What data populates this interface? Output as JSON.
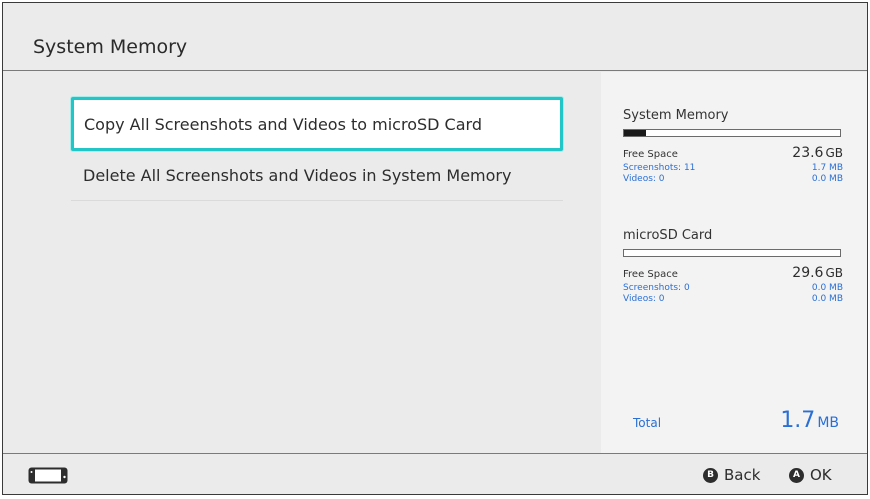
{
  "header": {
    "title": "System Memory"
  },
  "menu": {
    "items": [
      {
        "label": "Copy All Screenshots and Videos to microSD Card"
      },
      {
        "label": "Delete All Screenshots and Videos in System Memory"
      }
    ]
  },
  "system_memory": {
    "title": "System Memory",
    "used_fraction": 0.1,
    "free_label": "Free Space",
    "free_value": "23.6",
    "free_unit": "GB",
    "screenshots_label": "Screenshots: 11",
    "screenshots_size": "1.7 MB",
    "videos_label": "Videos: 0",
    "videos_size": "0.0 MB"
  },
  "microsd": {
    "title": "microSD Card",
    "used_fraction": 0.0,
    "free_label": "Free Space",
    "free_value": "29.6",
    "free_unit": "GB",
    "screenshots_label": "Screenshots: 0",
    "screenshots_size": "0.0 MB",
    "videos_label": "Videos: 0",
    "videos_size": "0.0 MB"
  },
  "total": {
    "label": "Total",
    "value": "1.7",
    "unit": "MB"
  },
  "footer": {
    "back_key": "B",
    "back_label": "Back",
    "ok_key": "A",
    "ok_label": "OK"
  },
  "colors": {
    "accent": "#2a6fd6",
    "selection": "#22c6c6"
  }
}
